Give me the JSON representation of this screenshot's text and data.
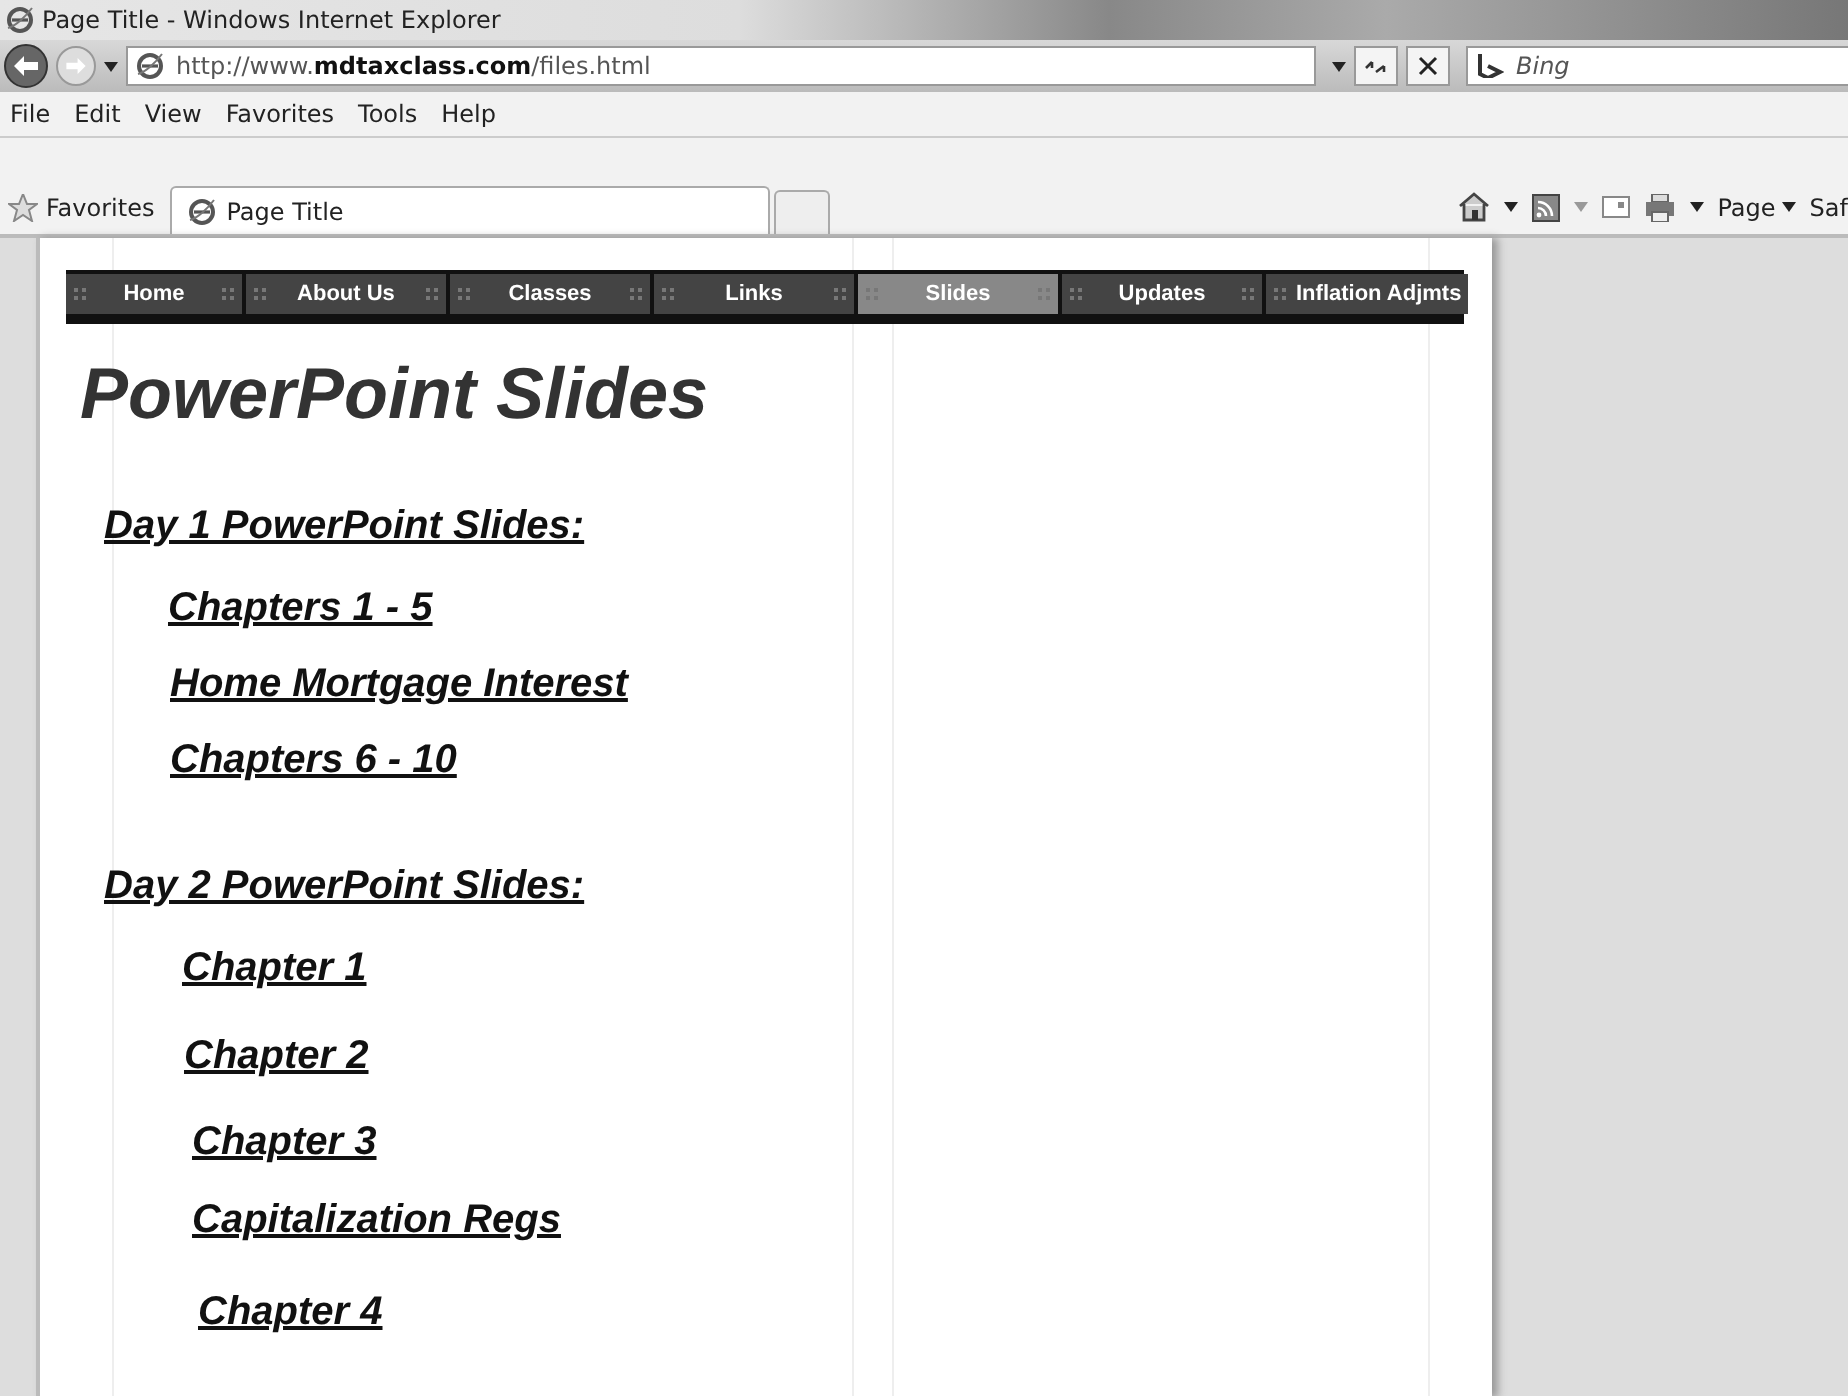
{
  "browser": {
    "title": "Page Title - Windows Internet Explorer",
    "address": "http://www.**mdtaxclass.com**/files.html",
    "search_placeholder": "Bing",
    "menu": [
      "File",
      "Edit",
      "View",
      "Favorites",
      "Tools",
      "Help"
    ],
    "favorites": "Favorites",
    "tabs": [
      {
        "label": "Page Title",
        "selected": true
      }
    ],
    "command_bar": [
      "Page",
      "Saf"
    ]
  },
  "nav": [
    {
      "label": "Home",
      "selected": false
    },
    {
      "label": "About Us",
      "selected": false
    },
    {
      "label": "Classes",
      "selected": false
    },
    {
      "label": "Links",
      "selected": false
    },
    {
      "label": "Slides",
      "selected": true
    },
    {
      "label": "Updates",
      "selected": false
    },
    {
      "label": "Inflation Adjmts",
      "selected": false
    }
  ],
  "page": {
    "title": "PowerPoint Slides",
    "sections": [
      {
        "heading": "Day 1 PowerPoint Slides:",
        "links": [
          "Chapters 1 - 5",
          "Home Mortgage Interest",
          "Chapters 6 - 10"
        ]
      },
      {
        "heading": "Day 2 PowerPoint Slides:",
        "links": [
          "Chapter 1",
          "Chapter 2",
          "Chapter 3",
          "Capitalization Regs",
          "Chapter 4"
        ]
      }
    ]
  }
}
